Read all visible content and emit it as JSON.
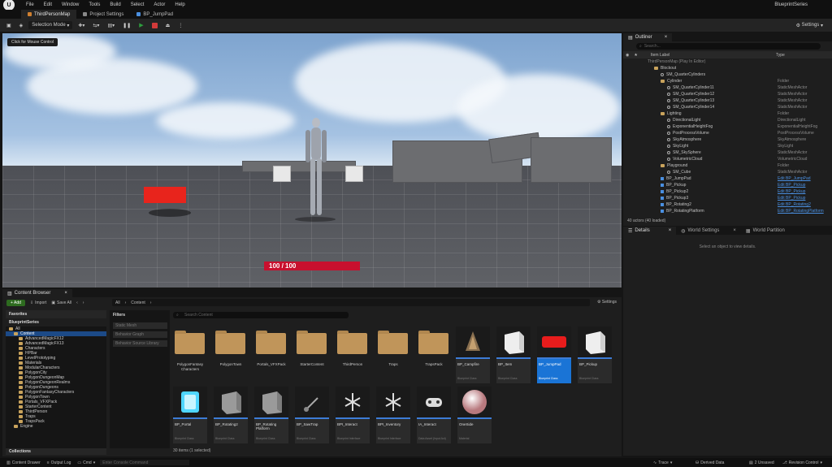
{
  "menubar": {
    "logo": "U",
    "items": [
      "File",
      "Edit",
      "Window",
      "Tools",
      "Build",
      "Select",
      "Actor",
      "Help"
    ],
    "project": "BlueprintSeries"
  },
  "tabs": [
    "ThirdPersonMap",
    "Project Settings",
    "BP_JumpPad"
  ],
  "toolbar": {
    "selection_mode": "Selection Mode",
    "settings": "Settings"
  },
  "viewport": {
    "mouse_control": "Click for Mouse Control",
    "health": "100 / 100"
  },
  "outliner": {
    "tab": "Outliner",
    "search_placeholder": "Search...",
    "col_label": "Item Label",
    "col_type": "Type",
    "rows": [
      {
        "label": "ThirdPersonMap (Play In Editor)",
        "type": "",
        "indent": 0,
        "icon": "none"
      },
      {
        "label": "Blockout",
        "type": "",
        "indent": 1,
        "icon": "folder"
      },
      {
        "label": "SM_QuarterCylinders",
        "type": "",
        "indent": 2,
        "icon": "mesh"
      },
      {
        "label": "Cylinder",
        "type": "Folder",
        "indent": 2,
        "icon": "folder"
      },
      {
        "label": "SM_QuarterCylinder11",
        "type": "StaticMeshActor",
        "indent": 3,
        "icon": "mesh"
      },
      {
        "label": "SM_QuarterCylinder12",
        "type": "StaticMeshActor",
        "indent": 3,
        "icon": "mesh"
      },
      {
        "label": "SM_QuarterCylinder13",
        "type": "StaticMeshActor",
        "indent": 3,
        "icon": "mesh"
      },
      {
        "label": "SM_QuarterCylinder14",
        "type": "StaticMeshActor",
        "indent": 3,
        "icon": "mesh"
      },
      {
        "label": "Lighting",
        "type": "Folder",
        "indent": 2,
        "icon": "folder"
      },
      {
        "label": "DirectionalLight",
        "type": "DirectionalLight",
        "indent": 3,
        "icon": "mesh"
      },
      {
        "label": "ExponentialHeightFog",
        "type": "ExponentialHeightFog",
        "indent": 3,
        "icon": "mesh"
      },
      {
        "label": "PostProcessVolume",
        "type": "PostProcessVolume",
        "indent": 3,
        "icon": "mesh"
      },
      {
        "label": "SkyAtmosphere",
        "type": "SkyAtmosphere",
        "indent": 3,
        "icon": "mesh"
      },
      {
        "label": "SkyLight",
        "type": "SkyLight",
        "indent": 3,
        "icon": "mesh"
      },
      {
        "label": "SM_SkySphere",
        "type": "StaticMeshActor",
        "indent": 3,
        "icon": "mesh"
      },
      {
        "label": "VolumetricCloud",
        "type": "VolumetricCloud",
        "indent": 3,
        "icon": "mesh"
      },
      {
        "label": "Playground",
        "type": "Folder",
        "indent": 2,
        "icon": "folder"
      },
      {
        "label": "SM_Cube",
        "type": "StaticMeshActor",
        "indent": 3,
        "icon": "mesh"
      },
      {
        "label": "BP_JumpPad",
        "type": "Edit BP_JumpPad",
        "indent": 2,
        "icon": "bp",
        "link": true
      },
      {
        "label": "BP_Pickup",
        "type": "Edit BP_Pickup",
        "indent": 2,
        "icon": "bp",
        "link": true
      },
      {
        "label": "BP_Pickup2",
        "type": "Edit BP_Pickup",
        "indent": 2,
        "icon": "bp",
        "link": true
      },
      {
        "label": "BP_Pickup3",
        "type": "Edit BP_Pickup",
        "indent": 2,
        "icon": "bp",
        "link": true
      },
      {
        "label": "BP_Rotating2",
        "type": "Edit BP_Rotating2",
        "indent": 2,
        "icon": "bp",
        "link": true
      },
      {
        "label": "BP_RotatingPlatform",
        "type": "Edit BP_RotatingPlatform",
        "indent": 2,
        "icon": "bp",
        "link": true
      }
    ],
    "actor_count": "40 actors (40 loaded)"
  },
  "details": {
    "tabs": [
      "Details",
      "World Settings",
      "World Partition"
    ],
    "empty": "Select an object to view details."
  },
  "content_browser": {
    "tab": "Content Browser",
    "add": "+ Add",
    "import": "Import",
    "save_all": "Save All",
    "path": [
      "All",
      "Content"
    ],
    "settings": "Settings",
    "favorites": "Favorites",
    "project": "BlueprintSeries",
    "tree": [
      {
        "label": "All",
        "indent": 0,
        "selected": false
      },
      {
        "label": "Content",
        "indent": 1,
        "selected": true
      },
      {
        "label": "AdvancedMagicFX12",
        "indent": 2,
        "selected": false
      },
      {
        "label": "AdvancedMagicFX13",
        "indent": 2,
        "selected": false
      },
      {
        "label": "Characters",
        "indent": 2,
        "selected": false
      },
      {
        "label": "HPBar",
        "indent": 2,
        "selected": false
      },
      {
        "label": "LevelPrototyping",
        "indent": 2,
        "selected": false
      },
      {
        "label": "Materials",
        "indent": 2,
        "selected": false
      },
      {
        "label": "ModularCharacters",
        "indent": 2,
        "selected": false
      },
      {
        "label": "PolygonCity",
        "indent": 2,
        "selected": false
      },
      {
        "label": "PolygonDungeonMap",
        "indent": 2,
        "selected": false
      },
      {
        "label": "PolygonDungeonRealms",
        "indent": 2,
        "selected": false
      },
      {
        "label": "PolygonDungeons",
        "indent": 2,
        "selected": false
      },
      {
        "label": "PolygonFantasyCharacters",
        "indent": 2,
        "selected": false
      },
      {
        "label": "PolygonTown",
        "indent": 2,
        "selected": false
      },
      {
        "label": "Portals_VFXPack",
        "indent": 2,
        "selected": false
      },
      {
        "label": "StarterContent",
        "indent": 2,
        "selected": false
      },
      {
        "label": "ThirdPerson",
        "indent": 2,
        "selected": false
      },
      {
        "label": "Traps",
        "indent": 2,
        "selected": false
      },
      {
        "label": "TrapsPack",
        "indent": 2,
        "selected": false
      },
      {
        "label": "Engine",
        "indent": 1,
        "selected": false
      }
    ],
    "collections": "Collections",
    "filters_title": "Filters",
    "filters": [
      "Static Mesh",
      "Behavior Graph",
      "Behavior Source Library"
    ],
    "search_placeholder": "Search Content",
    "folders": [
      "PolygonFantasy Characters",
      "PolygonTown",
      "Portals_VFXPack",
      "StarterContent",
      "ThirdPerson",
      "Traps",
      "TrapsPack"
    ],
    "assets_row1": [
      {
        "name": "BP_Campfire",
        "kind": "Blueprint Class",
        "thumb": "campfire"
      },
      {
        "name": "BP_Item",
        "kind": "Blueprint Class",
        "thumb": "cube-white"
      },
      {
        "name": "BP_JumpPad",
        "kind": "Blueprint Class",
        "thumb": "jumppad",
        "selected": true
      },
      {
        "name": "BP_Pickup",
        "kind": "Blueprint Class",
        "thumb": "cube-white"
      }
    ],
    "assets_row2": [
      {
        "name": "BP_Portal",
        "kind": "Blueprint Class",
        "thumb": "portal"
      },
      {
        "name": "BP_Rotating2",
        "kind": "Blueprint Class",
        "thumb": "cube-grey"
      },
      {
        "name": "BP_Rotating Platform",
        "kind": "Blueprint Class",
        "thumb": "cube-grey"
      },
      {
        "name": "BP_SawTrap",
        "kind": "Blueprint Class",
        "thumb": "saw"
      },
      {
        "name": "BPI_Interact",
        "kind": "Blueprint Interface",
        "thumb": "interface"
      },
      {
        "name": "BPI_Inventory",
        "kind": "Blueprint Interface",
        "thumb": "interface"
      },
      {
        "name": "IA_Interact",
        "kind": "Data Asset (Input Act)",
        "thumb": "gamepad"
      },
      {
        "name": "OneSide",
        "kind": "Material",
        "thumb": "sphere"
      }
    ],
    "item_count": "30 items (1 selected)"
  },
  "statusbar": {
    "content_drawer": "Content Drawer",
    "output_log": "Output Log",
    "cmd": "Cmd",
    "cmd_placeholder": "Enter Console Command",
    "trace": "Trace",
    "derived_data": "Derived Data",
    "unsaved": "2 Unsaved",
    "revision_control": "Revision Control"
  },
  "colors": {
    "accent": "#1a74d6",
    "health": "#c8102e",
    "add": "#2d6b1f"
  }
}
